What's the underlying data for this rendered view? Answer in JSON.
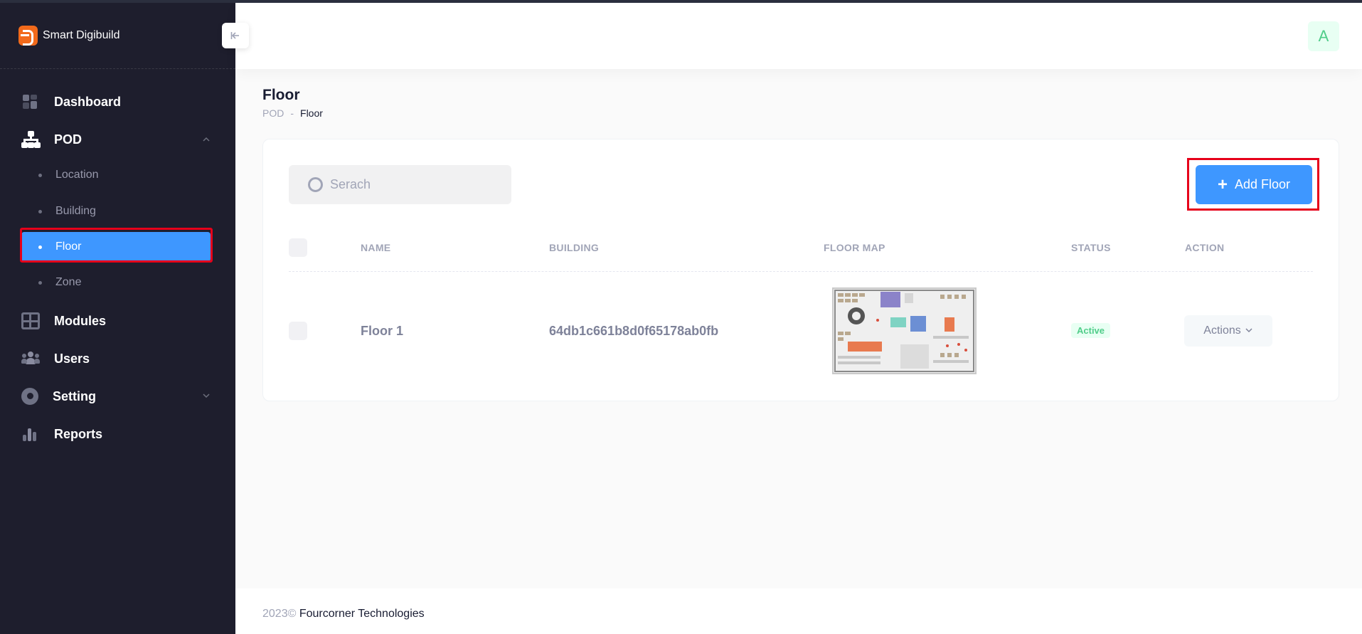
{
  "brand": {
    "name": "Smart Digibuild"
  },
  "sidebar": {
    "items": [
      {
        "label": "Dashboard",
        "icon": "dashboard-icon"
      },
      {
        "label": "POD",
        "icon": "sitemap-icon",
        "expanded": true,
        "children": [
          {
            "label": "Location",
            "active": false
          },
          {
            "label": "Building",
            "active": false
          },
          {
            "label": "Floor",
            "active": true
          },
          {
            "label": "Zone",
            "active": false
          }
        ]
      },
      {
        "label": "Modules",
        "icon": "grid-icon"
      },
      {
        "label": "Users",
        "icon": "users-icon"
      },
      {
        "label": "Setting",
        "icon": "gear-icon",
        "expanded": false
      },
      {
        "label": "Reports",
        "icon": "bar-chart-icon"
      }
    ]
  },
  "header": {
    "avatar_initial": "A"
  },
  "page": {
    "title": "Floor",
    "breadcrumb": [
      "POD",
      "-",
      "Floor"
    ]
  },
  "toolbar": {
    "search_placeholder": "Serach",
    "add_label": "Add Floor"
  },
  "table": {
    "columns": [
      "NAME",
      "BUILDING",
      "FLOOR MAP",
      "STATUS",
      "ACTION"
    ],
    "rows": [
      {
        "name": "Floor 1",
        "building": "64db1c661b8d0f65178ab0fb",
        "floor_map": "floor-plan-image",
        "status": "Active",
        "action_label": "Actions"
      }
    ]
  },
  "footer": {
    "year": "2023©",
    "company": "Fourcorner Technologies"
  },
  "colors": {
    "sidebar_bg": "#1e1e2d",
    "primary": "#3e97ff",
    "success": "#50cd89",
    "highlight": "#e6001a"
  }
}
